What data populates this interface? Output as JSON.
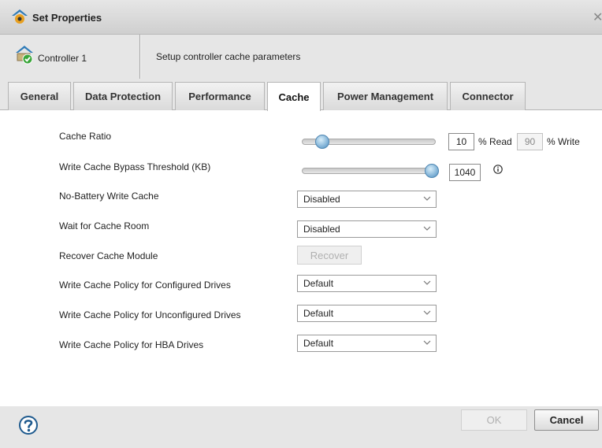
{
  "window": {
    "title": "Set Properties",
    "close_glyph": "✕",
    "title_icon": "controller-gear-icon"
  },
  "header": {
    "controller_label": "Controller 1",
    "controller_icon": "controller-ok-icon",
    "description": "Setup controller cache parameters"
  },
  "tabs": [
    {
      "label": "General",
      "active": false
    },
    {
      "label": "Data Protection",
      "active": false
    },
    {
      "label": "Performance",
      "active": false
    },
    {
      "label": "Cache",
      "active": true
    },
    {
      "label": "Power Management",
      "active": false
    },
    {
      "label": "Connector",
      "active": false
    }
  ],
  "cache": {
    "cache_ratio": {
      "label": "Cache Ratio",
      "read_value": "10",
      "read_unit": "% Read",
      "write_value": "90",
      "write_unit": "% Write",
      "slider_fraction": 0.1
    },
    "bypass_threshold": {
      "label": "Write Cache Bypass Threshold (KB)",
      "value": "1040",
      "slider_fraction": 1.0,
      "info_icon": "info-icon"
    },
    "no_battery_write_cache": {
      "label": "No-Battery Write Cache",
      "value": "Disabled"
    },
    "wait_for_cache_room": {
      "label": "Wait for Cache Room",
      "value": "Disabled"
    },
    "recover_cache_module": {
      "label": "Recover Cache Module",
      "button_label": "Recover",
      "enabled": false
    },
    "policy_configured": {
      "label": "Write Cache Policy for Configured Drives",
      "value": "Default"
    },
    "policy_unconfigured": {
      "label": "Write Cache Policy for Unconfigured Drives",
      "value": "Default"
    },
    "policy_hba": {
      "label": "Write Cache Policy for HBA Drives",
      "value": "Default"
    }
  },
  "footer": {
    "help_icon": "help-icon",
    "ok_label": "OK",
    "ok_enabled": false,
    "cancel_label": "Cancel"
  },
  "colors": {
    "chrome_gray": "#e6e6e6",
    "slider_thumb": "#6fa6cf",
    "help_blue": "#1e5a8e"
  }
}
